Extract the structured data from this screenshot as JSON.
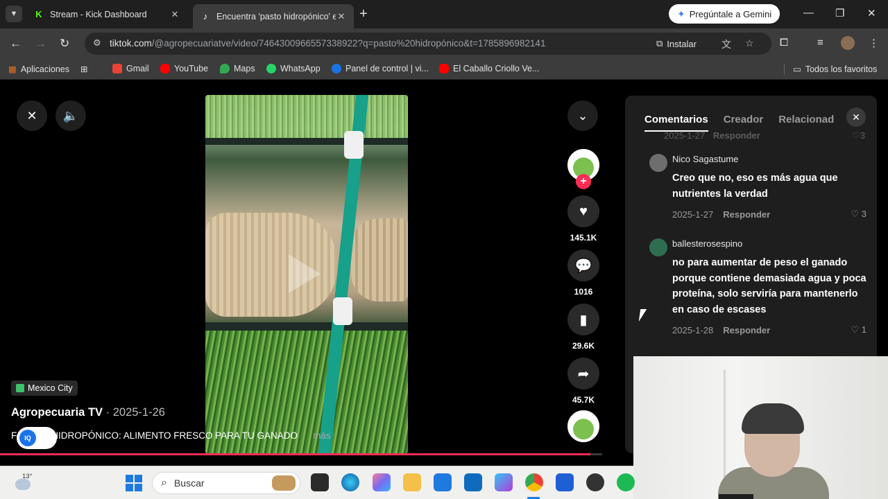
{
  "browser": {
    "tabs": [
      {
        "title": "Stream - Kick Dashboard",
        "favicon": "kick-icon"
      },
      {
        "title": "Encuentra 'pasto hidropónico' e",
        "favicon": "tiktok-icon"
      }
    ],
    "gemini_button": "Pregúntale a Gemini",
    "url_host": "tiktok.com",
    "url_path": "/@agropecuariatve/video/7464300966557338922?q=pasto%20hidropónico&t=1785896982141",
    "install_label": "Instalar",
    "bookmarks": [
      {
        "label": "Aplicaciones"
      },
      {
        "label": "Gmail",
        "color": "#ea4335"
      },
      {
        "label": "YouTube",
        "color": "#ff0000"
      },
      {
        "label": "Maps",
        "color": "#34a853"
      },
      {
        "label": "WhatsApp",
        "color": "#25d366"
      },
      {
        "label": "Panel de control | vi...",
        "color": "#1a73e8"
      },
      {
        "label": "El Caballo Criollo Ve...",
        "color": "#ff0000"
      }
    ],
    "all_favorites": "Todos los favoritos"
  },
  "video": {
    "likes": "145.1K",
    "comments": "1016",
    "saves": "29.6K",
    "shares": "45.7K",
    "location": "Mexico City",
    "author": "Agropecuaria TV",
    "author_sep": " · ",
    "date": "2025-1-26",
    "description_prefix": "F",
    "description": "HIDROPÓNICO: ALIMENTO FRESCO PARA TU GANADO",
    "more": "más",
    "progress": 0.98,
    "accent": "#fe2c55"
  },
  "panel": {
    "tabs": [
      "Comentarios",
      "Creador",
      "Relacionad"
    ],
    "ghost_date": "2025-1-27",
    "ghost_reply": "Responder",
    "ghost_likes": "3",
    "comments": [
      {
        "user": "Nico Sagastume",
        "text": "Creo que no, eso es más agua que nutrientes la verdad",
        "date": "2025-1-27",
        "reply": "Responder",
        "likes": "3"
      },
      {
        "user": "ballesterosespino",
        "text": "no para aumentar de peso el ganado porque contiene demasiada agua y poca proteína, solo serviría para mantenerlo en caso de escases",
        "date": "2025-1-28",
        "reply": "Responder",
        "likes": "1"
      }
    ]
  },
  "taskbar": {
    "temperature": "13°",
    "search_placeholder": "Buscar"
  }
}
